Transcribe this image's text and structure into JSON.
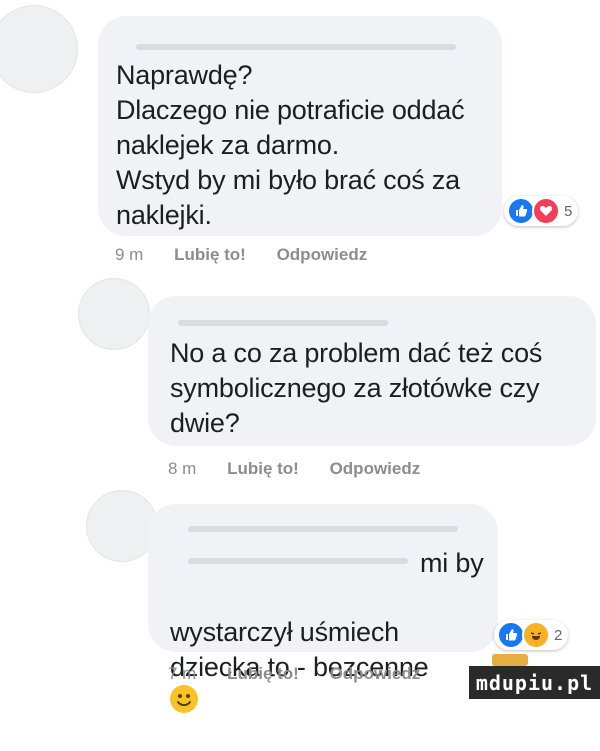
{
  "comments": [
    {
      "message": "Naprawdę?\nDlaczego nie potraficie oddać\nnaklejek za darmo.\nWstyd by mi było brać coś za\nnaklejki.",
      "time": "9 m",
      "like_label": "Lubię to!",
      "reply_label": "Odpowiedz",
      "reactions": [
        "like",
        "love"
      ],
      "reaction_count": "5"
    },
    {
      "message": "No a co za problem dać też coś\nsymbolicznego za złotówke czy\ndwie?",
      "time": "8 m",
      "like_label": "Lubię to!",
      "reply_label": "Odpowiedz"
    },
    {
      "message_line1": "mi by",
      "message_rest": "wystarczył uśmiech\ndziecka to - bezcenne",
      "time": "7 m",
      "like_label": "Lubię to!",
      "reply_label": "Odpowiedz",
      "reactions": [
        "like",
        "haha"
      ],
      "reaction_count": "2"
    }
  ],
  "watermark": "mdupiu.pl",
  "colors": {
    "like": "#1877f2",
    "love": "#f33e58",
    "haha": "#f7b125",
    "bubble": "#f0f2f5"
  }
}
